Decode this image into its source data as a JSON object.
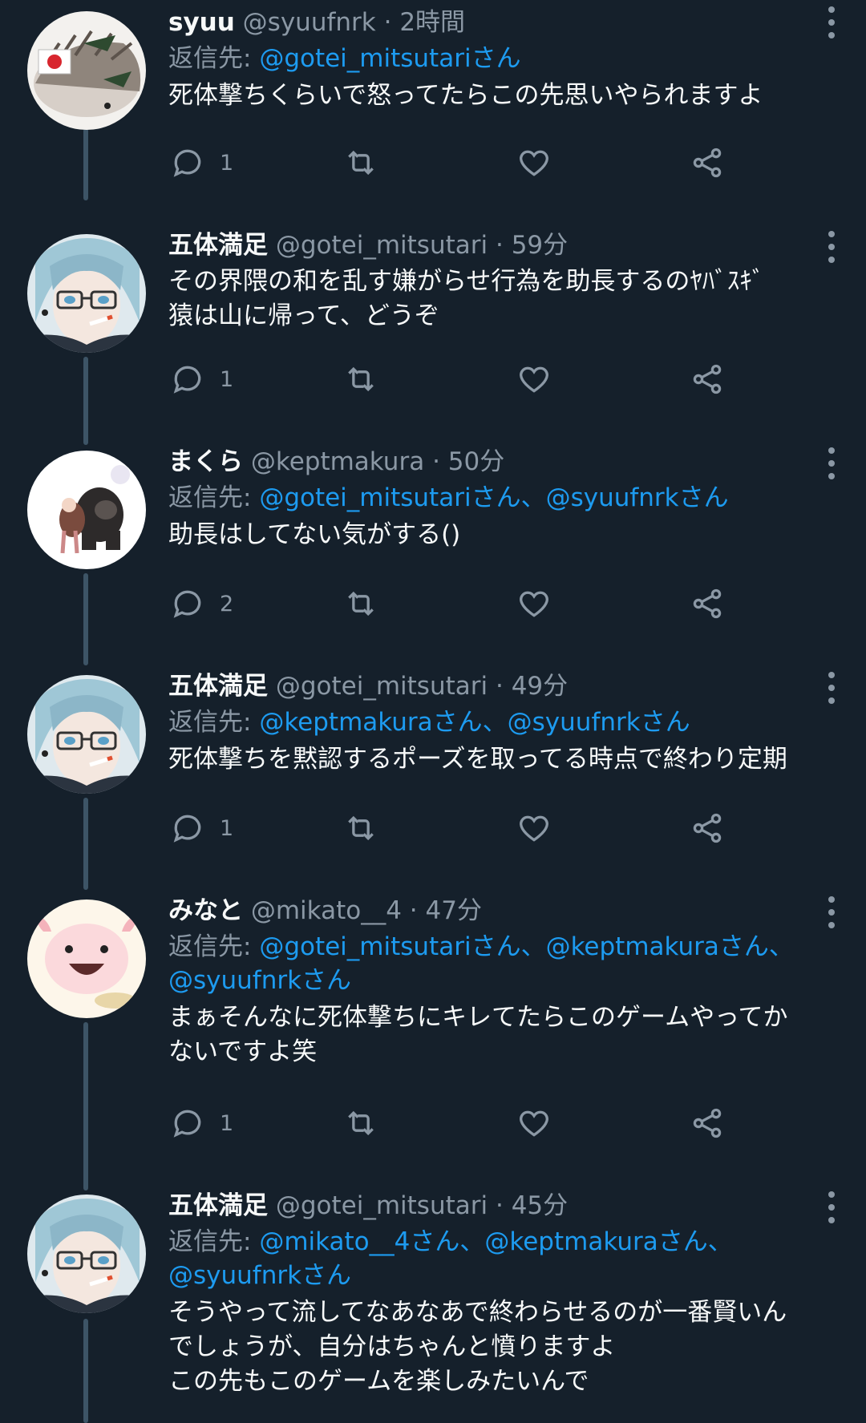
{
  "tweets": [
    {
      "name": "syuu",
      "handle": "@syuufnrk",
      "time": "2時間",
      "reply_prefix": "",
      "mentions": [
        "@gotei_mitsutariさん"
      ],
      "text_lines": [
        "死体撃ちくらいで怒ってたらこの先思いやられますよ"
      ],
      "reply_count": "1",
      "avatar": "hedgehog-avatar"
    },
    {
      "name": "五体満足",
      "handle": "@gotei_mitsutari",
      "time": "59分",
      "reply_prefix": "",
      "mentions": [],
      "text_lines": [
        "その界隈の和を乱す嫌がらせ行為を助長するのﾔﾊﾞｽｷﾞ",
        "猿は山に帰って、どうぞ"
      ],
      "reply_count": "1",
      "avatar": "anime-avatar"
    },
    {
      "name": "まくら",
      "handle": "@keptmakura",
      "time": "50分",
      "reply_prefix": "",
      "mentions": [
        "@gotei_mitsutariさん",
        "@syuufnrkさん"
      ],
      "text_lines": [
        "助長はしてない気がする()"
      ],
      "reply_count": "2",
      "avatar": "gorilla-avatar"
    },
    {
      "name": "五体満足",
      "handle": "@gotei_mitsutari",
      "time": "49分",
      "reply_prefix": "",
      "mentions": [
        "@keptmakuraさん",
        "@syuufnrkさん"
      ],
      "text_lines": [
        "死体撃ちを黙認するポーズを取ってる時点で終わり定期"
      ],
      "reply_count": "1",
      "avatar": "anime-avatar"
    },
    {
      "name": "みなと",
      "handle": "@mikato__4",
      "time": "47分",
      "reply_prefix": "",
      "mentions": [
        "@gotei_mitsutariさん",
        "@keptmakuraさん",
        "@syuufnrkさん"
      ],
      "text_lines": [
        "まぁそんなに死体撃ちにキレてたらこのゲームやってか",
        "ないですよ笑"
      ],
      "reply_count": "1",
      "avatar": "axolotl-avatar"
    },
    {
      "name": "五体満足",
      "handle": "@gotei_mitsutari",
      "time": "45分",
      "reply_prefix": "",
      "mentions": [
        "@mikato__4さん",
        "@keptmakuraさん",
        "@syuufnrkさん"
      ],
      "text_lines": [
        "そうやって流してなあなあで終わらせるのが一番賢いん",
        "でしょうが、自分はちゃんと憤りますよ",
        "この先もこのゲームを楽しみたいんで"
      ],
      "reply_count": "",
      "avatar": "anime-avatar"
    }
  ],
  "labels": {
    "reply_to": "返信先:",
    "separator": "、",
    "dot": "·"
  },
  "colors": {
    "background": "#15202b",
    "accent": "#1d9bf0",
    "secondary_text": "#8b98a5"
  }
}
